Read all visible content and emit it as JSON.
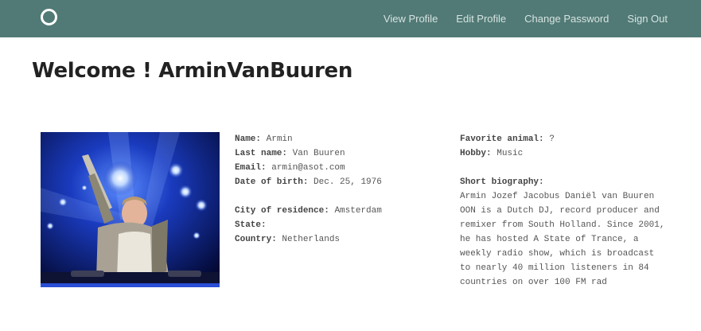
{
  "nav": {
    "links": [
      "View Profile",
      "Edit Profile",
      "Change Password",
      "Sign Out"
    ]
  },
  "header": {
    "welcome": "Welcome ! ArminVanBuuren"
  },
  "profile": {
    "name_label": "Name:",
    "name": "Armin",
    "last_name_label": "Last name:",
    "last_name": "Van Buuren",
    "email_label": "Email:",
    "email": "armin@asot.com",
    "dob_label": "Date of birth:",
    "dob": "Dec. 25, 1976",
    "city_label": "City of residence:",
    "city": "Amsterdam",
    "state_label": "State:",
    "state": "",
    "country_label": "Country:",
    "country": "Netherlands",
    "animal_label": "Favorite animal:",
    "animal": "?",
    "hobby_label": "Hobby:",
    "hobby": "Music",
    "bio_label": "Short biography:",
    "bio": "Armin Jozef Jacobus Daniël van Buuren OON is a Dutch DJ, record producer and remixer from South Holland. Since 2001, he has hosted A State of Trance, a weekly radio show, which is broadcast to nearly 40 million listeners in 84 countries on over 100 FM rad"
  },
  "colors": {
    "navbar": "#517a76",
    "nav_text": "#d6e3e1"
  }
}
